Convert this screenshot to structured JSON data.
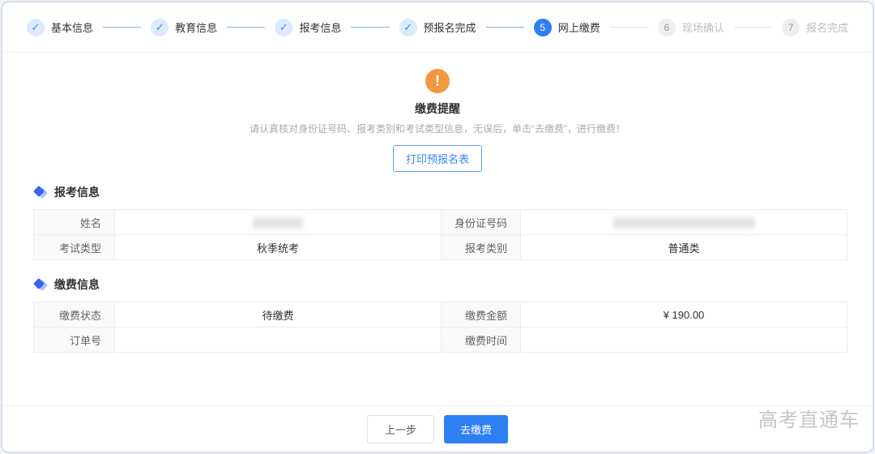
{
  "stepper": {
    "steps": [
      {
        "label": "基本信息",
        "state": "done"
      },
      {
        "label": "教育信息",
        "state": "done"
      },
      {
        "label": "报考信息",
        "state": "done"
      },
      {
        "label": "预报名完成",
        "state": "done"
      },
      {
        "label": "网上缴费",
        "state": "active",
        "num": "5"
      },
      {
        "label": "现场确认",
        "state": "pending",
        "num": "6"
      },
      {
        "label": "报名完成",
        "state": "pending",
        "num": "7"
      }
    ]
  },
  "notice": {
    "icon": "exclamation-icon",
    "icon_glyph": "!",
    "title": "缴费提醒",
    "description": "请认真核对身份证号码、报考类别和考试类型信息，无误后，单击“去缴费”，进行缴费！",
    "print_button_label": "打印预报名表"
  },
  "sections": [
    {
      "title": "报考信息",
      "rows": [
        {
          "label1": "姓名",
          "value1": "",
          "value1_redacted": true,
          "label2": "身份证号码",
          "value2": "",
          "value2_redacted": true
        },
        {
          "label1": "考试类型",
          "value1": "秋季统考",
          "value1_redacted": false,
          "label2": "报考类别",
          "value2": "普通类",
          "value2_redacted": false
        }
      ]
    },
    {
      "title": "缴费信息",
      "rows": [
        {
          "label1": "缴费状态",
          "value1": "待缴费",
          "value1_redacted": false,
          "label2": "缴费金额",
          "value2": "¥ 190.00",
          "value2_redacted": false
        },
        {
          "label1": "订单号",
          "value1": "",
          "value1_redacted": false,
          "label2": "缴费时间",
          "value2": "",
          "value2_redacted": false
        }
      ]
    }
  ],
  "footer": {
    "prev_label": "上一步",
    "pay_label": "去缴费"
  },
  "watermark": "高考直通车",
  "colors": {
    "accent_blue": "#2e7ff2",
    "warning_orange": "#f2993f",
    "done_circle_bg": "#dceafd",
    "pending_text": "#b9bcc2"
  }
}
